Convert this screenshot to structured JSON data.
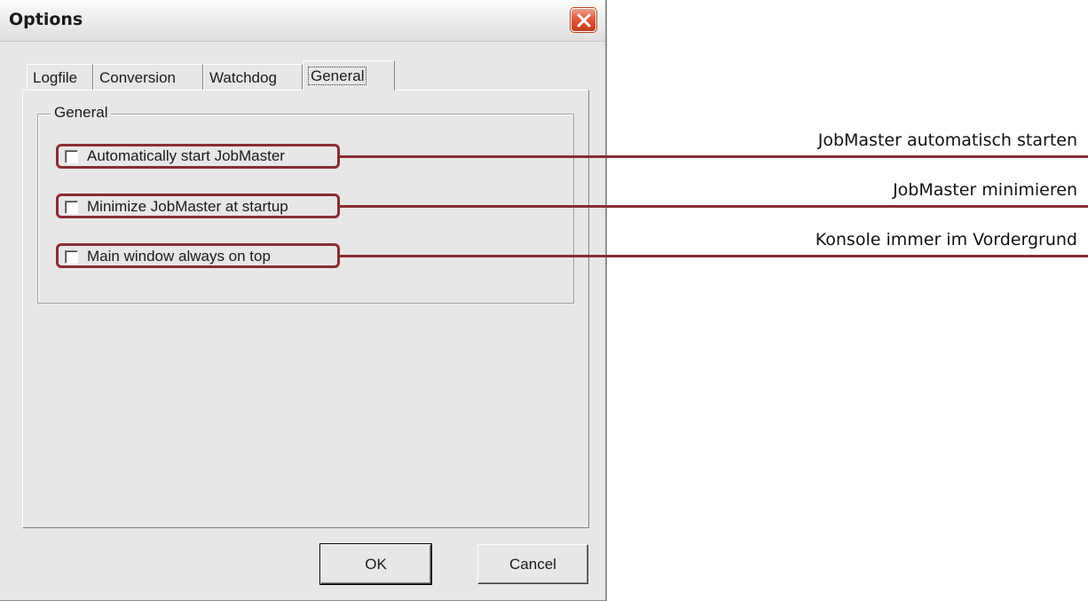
{
  "window": {
    "title": "Options",
    "close_icon": "close-icon"
  },
  "tabs": [
    {
      "label": "Logfile",
      "active": false
    },
    {
      "label": "Conversion",
      "active": false
    },
    {
      "label": "Watchdog",
      "active": false
    },
    {
      "label": "General",
      "active": true
    }
  ],
  "group": {
    "legend": "General",
    "options": [
      {
        "label": "Automatically start JobMaster",
        "checked": false,
        "annotation": "JobMaster automatisch starten"
      },
      {
        "label": "Minimize JobMaster at startup",
        "checked": false,
        "annotation": "JobMaster minimieren"
      },
      {
        "label": "Main window always on top",
        "checked": false,
        "annotation": "Konsole immer im Vordergrund"
      }
    ]
  },
  "buttons": {
    "ok": "OK",
    "cancel": "Cancel"
  },
  "colors": {
    "highlight": "#8b2d34",
    "window_bg": "#e7e7e7",
    "close_button": "#e0593a"
  }
}
